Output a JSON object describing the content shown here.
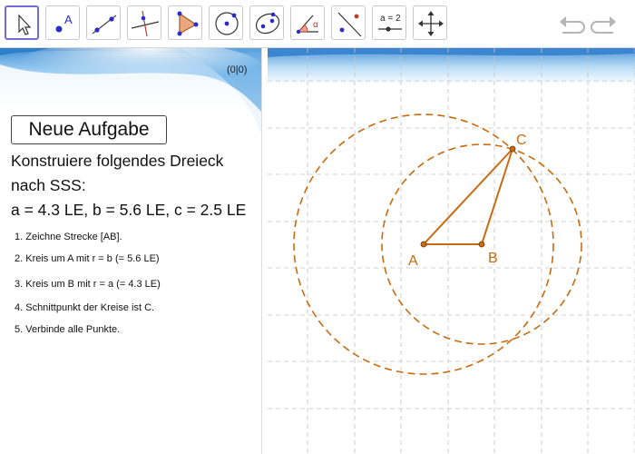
{
  "toolbar": {
    "tools": [
      {
        "icon": "move-arrow-icon",
        "selected": true
      },
      {
        "icon": "point-icon",
        "label": "A"
      },
      {
        "icon": "segment-icon"
      },
      {
        "icon": "perpendicular-line-icon"
      },
      {
        "icon": "polygon-icon"
      },
      {
        "icon": "circle-center-point-icon"
      },
      {
        "icon": "conic-icon"
      },
      {
        "icon": "angle-icon",
        "label": "α"
      },
      {
        "icon": "reflect-icon"
      },
      {
        "icon": "slider-icon",
        "label": "a = 2"
      },
      {
        "icon": "move-graphics-view-icon"
      }
    ],
    "undo_icon": "undo-icon",
    "redo_icon": "redo-icon"
  },
  "panel": {
    "coord_readout": "(0|0)",
    "new_task_label": "Neue Aufgabe",
    "task_line1": "Konstruiere folgendes Dreieck",
    "task_line2": "nach SSS:",
    "task_line3": "a = 4.3 LE, b = 5.6 LE, c = 2.5 LE",
    "steps": [
      "1. Zeichne Strecke [AB].",
      "2. Kreis um A mit r = b (= 5.6 LE)",
      "3. Kreis um B mit r = a (= 4.3 LE)",
      "4. Schnittpunkt der Kreise ist C.",
      "5. Verbinde alle Punkte."
    ]
  },
  "graphics": {
    "points": {
      "A": "A",
      "B": "B",
      "C": "C"
    },
    "construction_color": "#c86b10",
    "grid_color": "#c4c4c4"
  }
}
